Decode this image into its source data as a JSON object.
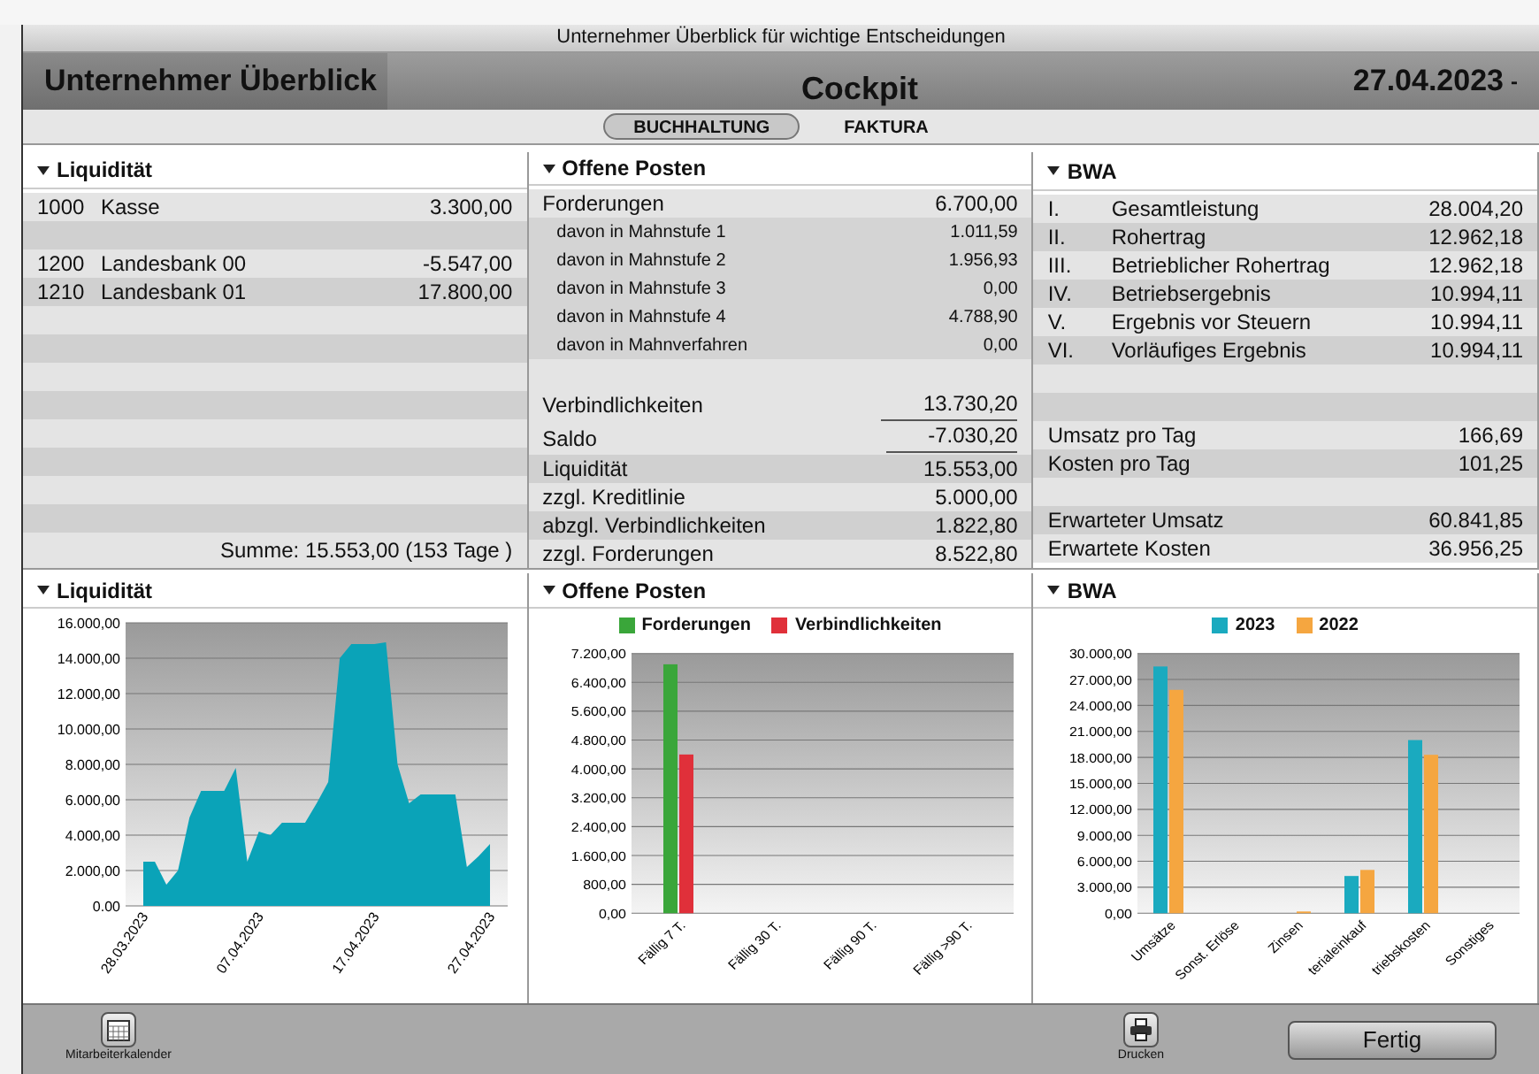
{
  "window": {
    "title": "Unternehmer Überblick für wichtige Entscheidungen"
  },
  "header": {
    "title": "Unternehmer Überblick",
    "center": "Cockpit",
    "date": "27.04.2023",
    "date_caret": "-"
  },
  "tabs": [
    {
      "label": "BUCHHALTUNG",
      "selected": true
    },
    {
      "label": "FAKTURA",
      "selected": false
    }
  ],
  "panels": [
    {
      "title": "Liquidität",
      "rows": [
        {
          "kind": "account",
          "code": "1000",
          "label": "Kasse",
          "value": "3.300,00"
        },
        {
          "kind": "spacer"
        },
        {
          "kind": "account",
          "code": "1200",
          "label": "Landesbank 00",
          "value": "-5.547,00"
        },
        {
          "kind": "account",
          "code": "1210",
          "label": "Landesbank 01",
          "value": "17.800,00"
        }
      ],
      "footer": "Summe: 15.553,00 (153 Tage )"
    },
    {
      "title": "Offene Posten",
      "rows": [
        {
          "kind": "main",
          "label": "Forderungen",
          "value": "6.700,00"
        },
        {
          "kind": "sub",
          "label": "davon in Mahnstufe 1",
          "value": "1.011,59"
        },
        {
          "kind": "sub",
          "label": "davon in Mahnstufe 2",
          "value": "1.956,93"
        },
        {
          "kind": "sub",
          "label": "davon in Mahnstufe 3",
          "value": "0,00"
        },
        {
          "kind": "sub",
          "label": "davon in Mahnstufe 4",
          "value": "4.788,90"
        },
        {
          "kind": "sub",
          "label": "davon in Mahnverfahren",
          "value": "0,00"
        },
        {
          "kind": "spacer"
        },
        {
          "kind": "underlined",
          "label": "Verbindlichkeiten",
          "value": "13.730,20"
        },
        {
          "kind": "double",
          "label": "Saldo",
          "value": "-7.030,20"
        },
        {
          "kind": "main",
          "label": "Liquidität",
          "value": "15.553,00"
        },
        {
          "kind": "main",
          "label": "zzgl. Kreditlinie",
          "value": "5.000,00"
        },
        {
          "kind": "main",
          "label": "abzgl. Verbindlichkeiten",
          "value": "1.822,80"
        },
        {
          "kind": "main",
          "label": "zzgl. Forderungen",
          "value": "8.522,80"
        }
      ]
    },
    {
      "title": "BWA",
      "rows": [
        {
          "kind": "account",
          "code": "I.",
          "label": "Gesamtleistung",
          "value": "28.004,20"
        },
        {
          "kind": "account",
          "code": "II.",
          "label": "Rohertrag",
          "value": "12.962,18"
        },
        {
          "kind": "account",
          "code": "III.",
          "label": "Betrieblicher Rohertrag",
          "value": "12.962,18"
        },
        {
          "kind": "account",
          "code": "IV.",
          "label": "Betriebsergebnis",
          "value": "10.994,11"
        },
        {
          "kind": "account",
          "code": "V.",
          "label": "Ergebnis vor Steuern",
          "value": "10.994,11"
        },
        {
          "kind": "account",
          "code": "VI.",
          "label": "Vorläufiges Ergebnis",
          "value": "10.994,11"
        },
        {
          "kind": "spacer"
        },
        {
          "kind": "spacer"
        },
        {
          "kind": "main",
          "label": "Umsatz pro Tag",
          "value": "166,69"
        },
        {
          "kind": "main",
          "label": "Kosten pro Tag",
          "value": "101,25"
        },
        {
          "kind": "spacer"
        },
        {
          "kind": "main",
          "label": "Erwarteter Umsatz",
          "value": "60.841,85"
        },
        {
          "kind": "main",
          "label": "Erwartete Kosten",
          "value": "36.956,25"
        }
      ]
    }
  ],
  "charts": [
    {
      "title": "Liquidität",
      "chart_data": {
        "type": "area",
        "grid": true,
        "categories": [
          "28.03.2023",
          null,
          null,
          null,
          null,
          null,
          null,
          null,
          null,
          null,
          "07.04.2023",
          null,
          null,
          null,
          null,
          null,
          null,
          null,
          null,
          null,
          "17.04.2023",
          null,
          null,
          null,
          null,
          null,
          null,
          null,
          null,
          null,
          "27.04.2023"
        ],
        "series": [
          {
            "color": "#0aa3b8",
            "values": [
              2500,
              2500,
              1200,
              2000,
              5000,
              6500,
              6500,
              6500,
              7800,
              2500,
              4200,
              4000,
              4700,
              4700,
              4700,
              5800,
              7000,
              14000,
              14800,
              14800,
              14800,
              14900,
              8000,
              5800,
              6300,
              6300,
              6300,
              6300,
              2200,
              2800,
              3500
            ]
          }
        ],
        "ylim": [
          0,
          16000
        ],
        "yticks": [
          {
            "value": 0,
            "label": "0.00"
          },
          {
            "value": 2000,
            "label": "2.000,00"
          },
          {
            "value": 4000,
            "label": "4.000,00"
          },
          {
            "value": 6000,
            "label": "6.000,00"
          },
          {
            "value": 8000,
            "label": "8.000,00"
          },
          {
            "value": 10000,
            "label": "10.000,00"
          },
          {
            "value": 12000,
            "label": "12.000,00"
          },
          {
            "value": 14000,
            "label": "14.000,00"
          },
          {
            "value": 16000,
            "label": "16.000,00"
          }
        ]
      }
    },
    {
      "title": "Offene Posten",
      "chart_data": {
        "type": "bar",
        "grid": true,
        "categories": [
          "Fällig 7 T.",
          "Fällig 30 T.",
          "Fällig 90 T.",
          "Fällig >90 T."
        ],
        "series": [
          {
            "name": "Forderungen",
            "color": "#3aa63a",
            "values": [
              6900,
              0,
              0,
              0
            ]
          },
          {
            "name": "Verbindlichkeiten",
            "color": "#e0303a",
            "values": [
              4400,
              0,
              0,
              0
            ]
          }
        ],
        "ylim": [
          0,
          7200
        ],
        "yticks": [
          {
            "value": 0,
            "label": "0,00"
          },
          {
            "value": 800,
            "label": "800,00"
          },
          {
            "value": 1600,
            "label": "1.600,00"
          },
          {
            "value": 2400,
            "label": "2.400,00"
          },
          {
            "value": 3200,
            "label": "3.200,00"
          },
          {
            "value": 4000,
            "label": "4.000,00"
          },
          {
            "value": 4800,
            "label": "4.800,00"
          },
          {
            "value": 5600,
            "label": "5.600,00"
          },
          {
            "value": 6400,
            "label": "6.400,00"
          },
          {
            "value": 7200,
            "label": "7.200,00"
          }
        ]
      }
    },
    {
      "title": "BWA",
      "chart_data": {
        "type": "bar",
        "grid": true,
        "categories": [
          "Umsätze",
          "Sonst. Erlöse",
          "Zinsen",
          "terialeinkauf",
          "triebskosten",
          "Sonstiges"
        ],
        "series": [
          {
            "name": "2023",
            "color": "#1aaabf",
            "values": [
              28500,
              0,
              0,
              4300,
              20000,
              0
            ]
          },
          {
            "name": "2022",
            "color": "#f5a640",
            "values": [
              25800,
              0,
              200,
              5000,
              18300,
              0
            ]
          }
        ],
        "ylim": [
          0,
          30000
        ],
        "yticks": [
          {
            "value": 0,
            "label": "0,00"
          },
          {
            "value": 3000,
            "label": "3.000,00"
          },
          {
            "value": 6000,
            "label": "6.000,00"
          },
          {
            "value": 9000,
            "label": "9.000,00"
          },
          {
            "value": 12000,
            "label": "12.000,00"
          },
          {
            "value": 15000,
            "label": "15.000,00"
          },
          {
            "value": 18000,
            "label": "18.000,00"
          },
          {
            "value": 21000,
            "label": "21.000,00"
          },
          {
            "value": 24000,
            "label": "24.000,00"
          },
          {
            "value": 27000,
            "label": "27.000,00"
          },
          {
            "value": 30000,
            "label": "30.000,00"
          }
        ]
      }
    }
  ],
  "toolbar": {
    "left_button": "Mitarbeiterkalender",
    "print_button": "Drucken",
    "done_button": "Fertig"
  }
}
